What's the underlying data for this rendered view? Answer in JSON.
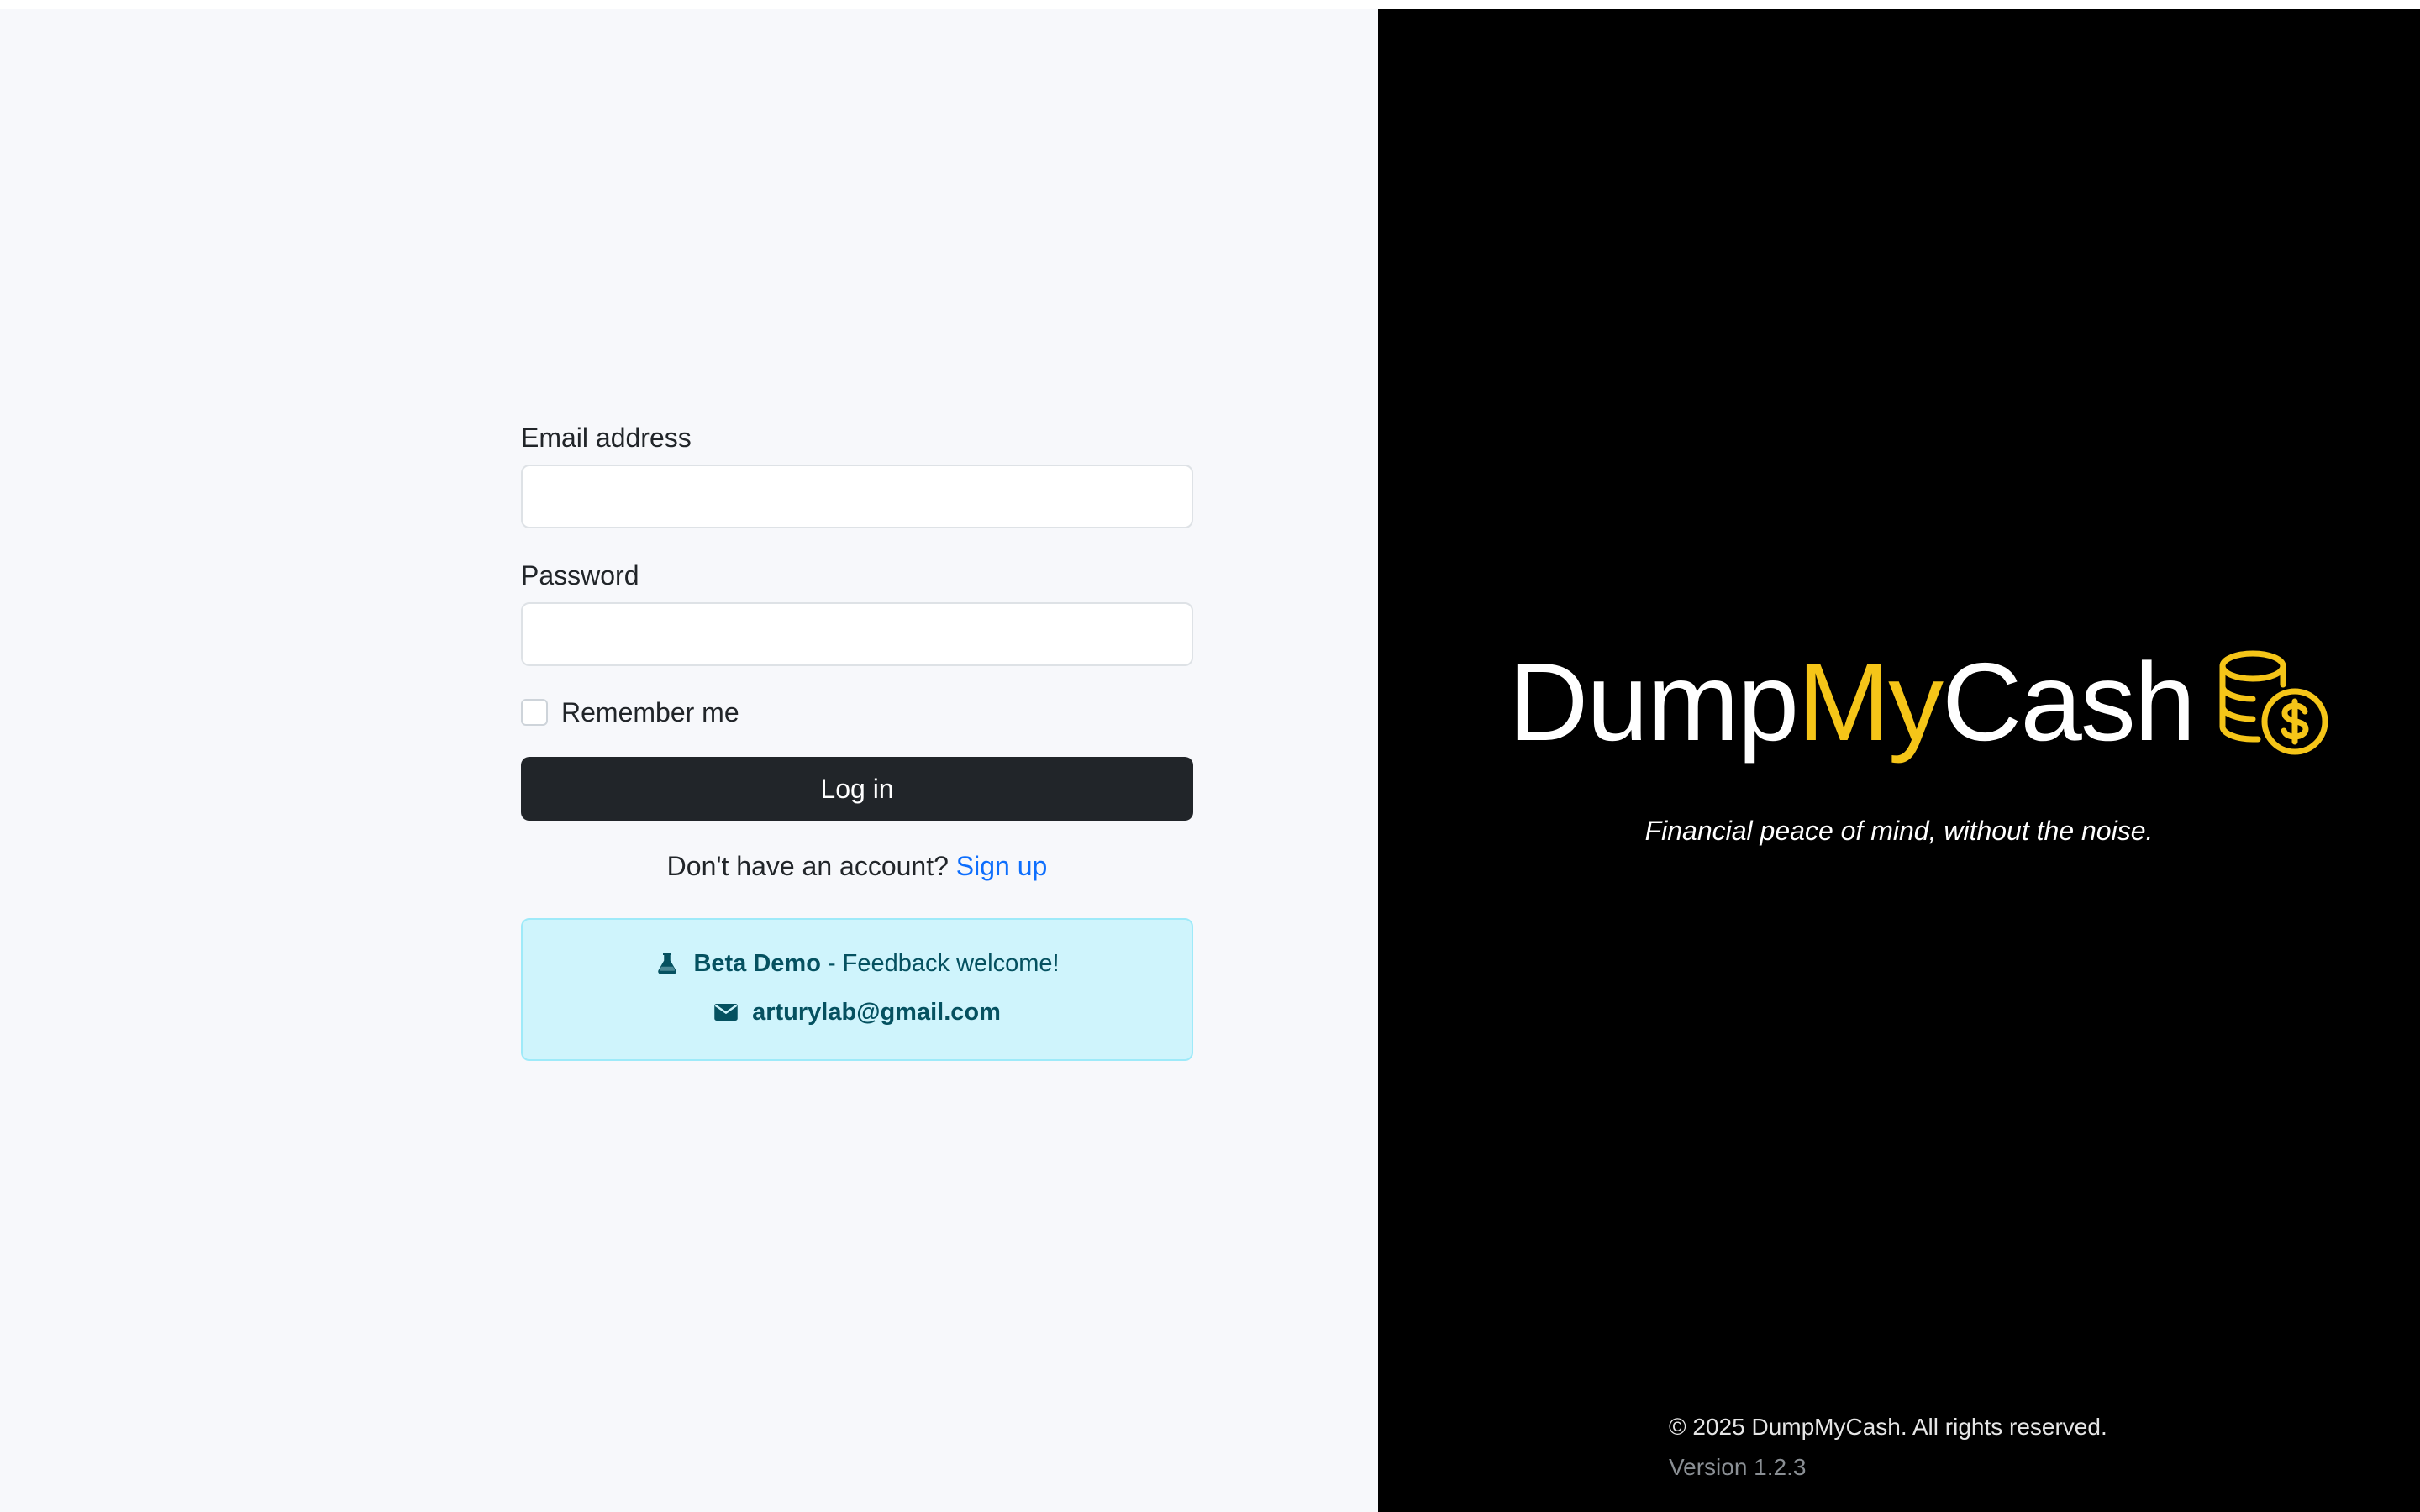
{
  "login": {
    "email_label": "Email address",
    "email_value": "",
    "password_label": "Password",
    "password_value": "",
    "remember_label": "Remember me",
    "remember_checked": false,
    "login_button": "Log in",
    "signup_prompt": "Don't have an account?",
    "signup_link": "Sign up"
  },
  "beta": {
    "title": "Beta Demo",
    "message": "- Feedback welcome!",
    "email": "arturylab@gmail.com",
    "flask_icon": "flask-icon",
    "envelope_icon": "envelope-icon"
  },
  "brand": {
    "part1": "Dump",
    "part2": "My",
    "part3": "Cash",
    "icon": "coins-dollar-icon",
    "tagline": "Financial peace of mind, without the noise.",
    "accent_color": "#f5c518"
  },
  "footer": {
    "copyright": "© 2025 DumpMyCash. All rights reserved.",
    "version": "Version 1.2.3"
  },
  "colors": {
    "left_bg": "#f7f8fb",
    "right_bg": "#000000",
    "button_bg": "#212529",
    "link": "#0d6efd",
    "alert_bg": "#cff4fc",
    "alert_text": "#055160"
  }
}
